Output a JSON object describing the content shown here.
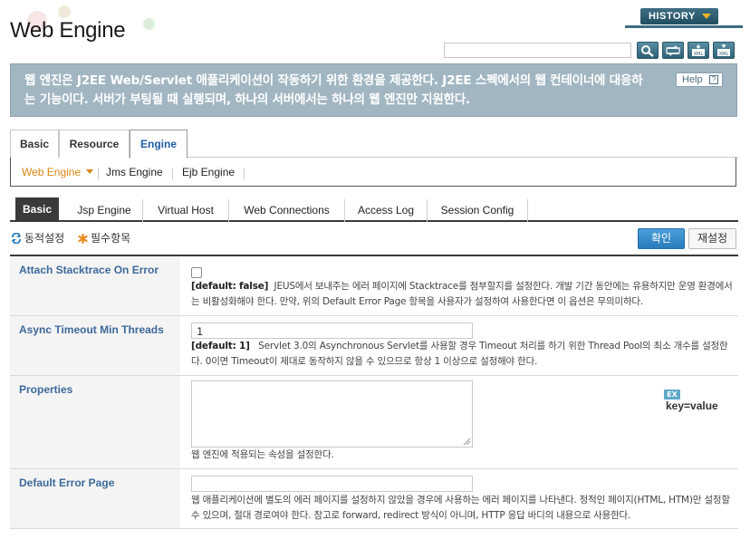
{
  "header": {
    "title": "Web Engine",
    "history_label": "HISTORY",
    "search_value": "",
    "tools": [
      "search-icon",
      "refresh-icon",
      "xml-import-icon",
      "xml-export-icon"
    ]
  },
  "banner": {
    "text": "웹 엔진은 J2EE Web/Servlet 애플리케이션이 작동하기 위한 환경을 제공한다. J2EE 스펙에서의 웹 컨테이너에 대응하는 기능이다. 서버가 부팅될 때 실행되며, 하나의 서버에서는 하나의 웹 엔진만 지원한다.",
    "help_label": "Help"
  },
  "tabs": [
    {
      "label": "Basic",
      "active": false
    },
    {
      "label": "Resource",
      "active": false
    },
    {
      "label": "Engine",
      "active": true
    }
  ],
  "subnav": [
    {
      "label": "Web Engine",
      "active": true
    },
    {
      "label": "Jms Engine",
      "active": false
    },
    {
      "label": "Ejb Engine",
      "active": false
    }
  ],
  "subtabs": [
    {
      "label": "Basic",
      "active": true
    },
    {
      "label": "Jsp Engine",
      "active": false
    },
    {
      "label": "Virtual Host",
      "active": false
    },
    {
      "label": "Web Connections",
      "active": false
    },
    {
      "label": "Access Log",
      "active": false
    },
    {
      "label": "Session Config",
      "active": false
    }
  ],
  "legend": {
    "dynamic": "동적설정",
    "required": "필수항목"
  },
  "actions": {
    "confirm": "확인",
    "reset": "재설정"
  },
  "colors": {
    "accent": "#2a7cbc",
    "banner": "#a2b6c2",
    "label": "#3d6a9b",
    "active_subnav": "#d98412"
  },
  "rows": [
    {
      "label": "Attach Stacktrace On Error",
      "checked": false,
      "default": "[default: false]",
      "desc": "JEUS에서 보내주는 에러 페이지에 Stacktrace를 첨부할지를 설정한다. 개발 기간 동안에는 유용하지만 운영 환경에서는 비활성화해야 한다. 만약, 위의 Default Error Page 항목을 사용자가 설정하여 사용한다면 이 옵션은 무의미하다."
    },
    {
      "label": "Async Timeout Min Threads",
      "value": "1",
      "default": "[default: 1]",
      "desc": "Servlet 3.0의 Asynchronous Servlet를 사용할 경우 Timeout 처리를 하기 위한 Thread Pool의 최소 개수를 설정한다. 0이면 Timeout이 제대로 동작하지 않을 수 있으므로 항상 1 이상으로 설정해야 한다."
    },
    {
      "label": "Properties",
      "value": "",
      "badge": "EX",
      "badge_text": "key=value",
      "desc": "웹 엔진에 적용되는 속성을 설정한다."
    },
    {
      "label": "Default Error Page",
      "value": "",
      "desc": "웹 애플리케이션에 별도의 에러 페이지를 설정하지 않았을 경우에 사용하는 에러 페이지를 나타낸다. 정적인 페이지(HTML, HTM)만 설정할 수 있으며, 절대 경로여야 한다. 참고로 forward, redirect 방식이 아니며, HTTP 응답 바디의 내용으로 사용한다."
    }
  ]
}
